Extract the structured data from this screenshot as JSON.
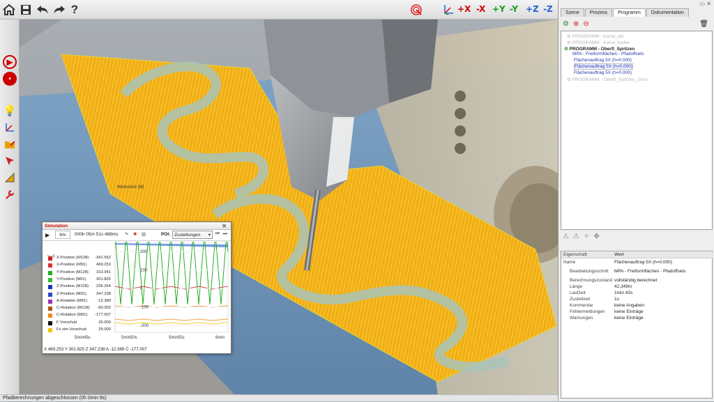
{
  "toolbar": {
    "icons": [
      "home-icon",
      "save-icon",
      "undo-icon",
      "redo-icon",
      "help-icon"
    ],
    "help_label": "?",
    "axis_buttons": [
      "+X",
      "-X",
      "+Y",
      "-Y",
      "+Z",
      "-Z"
    ],
    "axis_colors": [
      "#cc0000",
      "#cc0000",
      "#1a9a1a",
      "#1a9a1a",
      "#1f5fd0",
      "#1f5fd0"
    ]
  },
  "viewport": {
    "workpiece_label": "Werkstück (M)"
  },
  "status_bar": {
    "text": "Pfadberechnungen abgeschlossen (0h 0min 9s)"
  },
  "tabs": [
    "Szene",
    "Prozess",
    "Programm",
    "Dokumentation"
  ],
  "active_tab": "Programm",
  "tree": [
    {
      "label": "PROGRAMM - Kanal_ukt",
      "style": "disabled"
    },
    {
      "label": "PROGRAMM - Kanal_fueller",
      "style": "disabled"
    },
    {
      "label": "PROGRAMM - Oberfl_Spritzen",
      "style": "bold"
    },
    {
      "label": "MPA - Freiformflächen - Pfadoffsets",
      "style": "blue"
    },
    {
      "label": "Flächenauftrag 5X (h=0.000)",
      "style": "blue"
    },
    {
      "label": "Flächenauftrag 5X (h=0.000)",
      "style": "blue-selected"
    },
    {
      "label": "Flächenauftrag 5X (h=0.000)",
      "style": "blue"
    },
    {
      "label": "PROGRAMM - Oberfl_Spritzen_2mm",
      "style": "disabled"
    }
  ],
  "properties": {
    "header_key": "Eigenschaft",
    "header_value": "Wert",
    "rows": [
      {
        "k": "Name",
        "v": "Flächenauftrag 5X (h=0.000)"
      },
      {
        "k": "Bearbeitungsschritt",
        "v": "MPA - Freiformflächen - Pfadoffsets"
      },
      {
        "k": "Berechnungszustand",
        "v": "vollständig berechnet"
      },
      {
        "k": "Länge",
        "v": "42,349m"
      },
      {
        "k": "Laufzeit",
        "v": "1min 42s"
      },
      {
        "k": "Zustellzeit",
        "v": "1s"
      },
      {
        "k": "Kommentar",
        "v": "keine Angaben"
      },
      {
        "k": "Fehlermeldungen",
        "v": "keine Einträge"
      },
      {
        "k": "Warnungen",
        "v": "keine Einträge"
      }
    ]
  },
  "simulation": {
    "title": "Simulation",
    "speed": "6%",
    "time": "000h 05m 51s 488ms",
    "poi_label": "POI:",
    "poi_value": "Zustellungen",
    "legend": [
      {
        "name": "X-Position (M128)",
        "value": "-341.552",
        "color": "#cc2222"
      },
      {
        "name": "X-Position (M91)",
        "value": "469.253",
        "color": "#dd3333"
      },
      {
        "name": "Y-Position (M128)",
        "value": "163.941",
        "color": "#22aa22"
      },
      {
        "name": "Y-Position (M91)",
        "value": "301.825",
        "color": "#33bb33"
      },
      {
        "name": "Z-Position (M128)",
        "value": "236.254",
        "color": "#2233bb"
      },
      {
        "name": "Z-Position (M91)",
        "value": "347.238",
        "color": "#3344cc"
      },
      {
        "name": "A-Rotation (M91)",
        "value": "-12.389",
        "color": "#9933aa"
      },
      {
        "name": "C-Rotation (M128)",
        "value": "-90.002",
        "color": "#aa5511"
      },
      {
        "name": "C-Rotation (M91)",
        "value": "-177.007",
        "color": "#ee8822"
      },
      {
        "name": "F Vorschub",
        "value": "25.000",
        "color": "#111111"
      },
      {
        "name": "Fs sim.Vorschub",
        "value": "25.000",
        "color": "#f2c600"
      }
    ],
    "y_ticks": [
      "200",
      "100",
      "0",
      "-100",
      "-200"
    ],
    "x_ticks": [
      "5min45s",
      "5min50s",
      "5min55s",
      "6min"
    ],
    "coords": "X 469.253   Y 301.825  Z 347.238   A -12.389   C -177.007"
  }
}
